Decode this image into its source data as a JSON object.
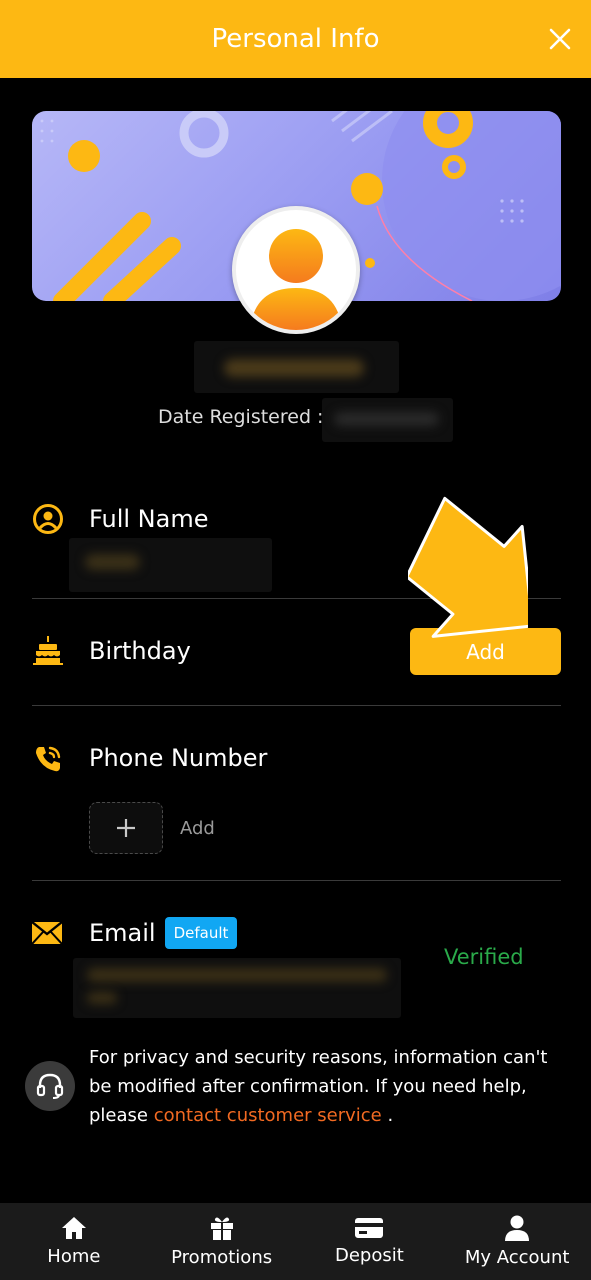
{
  "header": {
    "title": "Personal Info"
  },
  "profile": {
    "date_registered_label": "Date Registered :"
  },
  "rows": {
    "full_name": {
      "label": "Full Name"
    },
    "birthday": {
      "label": "Birthday",
      "add_label": "Add"
    },
    "phone": {
      "label": "Phone Number",
      "add_label": "Add"
    },
    "email": {
      "label": "Email",
      "badge": "Default",
      "status": "Verified"
    }
  },
  "notice": {
    "text": "For privacy and security reasons, information can't be modified after confirmation. If you need help, please ",
    "link": "contact customer service",
    "end": " ."
  },
  "nav": [
    {
      "label": "Home",
      "icon": "home-icon"
    },
    {
      "label": "Promotions",
      "icon": "gift-icon"
    },
    {
      "label": "Deposit",
      "icon": "card-icon"
    },
    {
      "label": "My Account",
      "icon": "user-icon"
    }
  ],
  "colors": {
    "accent": "#fdb813",
    "verified": "#2aaa4a",
    "link": "#f26a22",
    "badge": "#11a7f3"
  }
}
